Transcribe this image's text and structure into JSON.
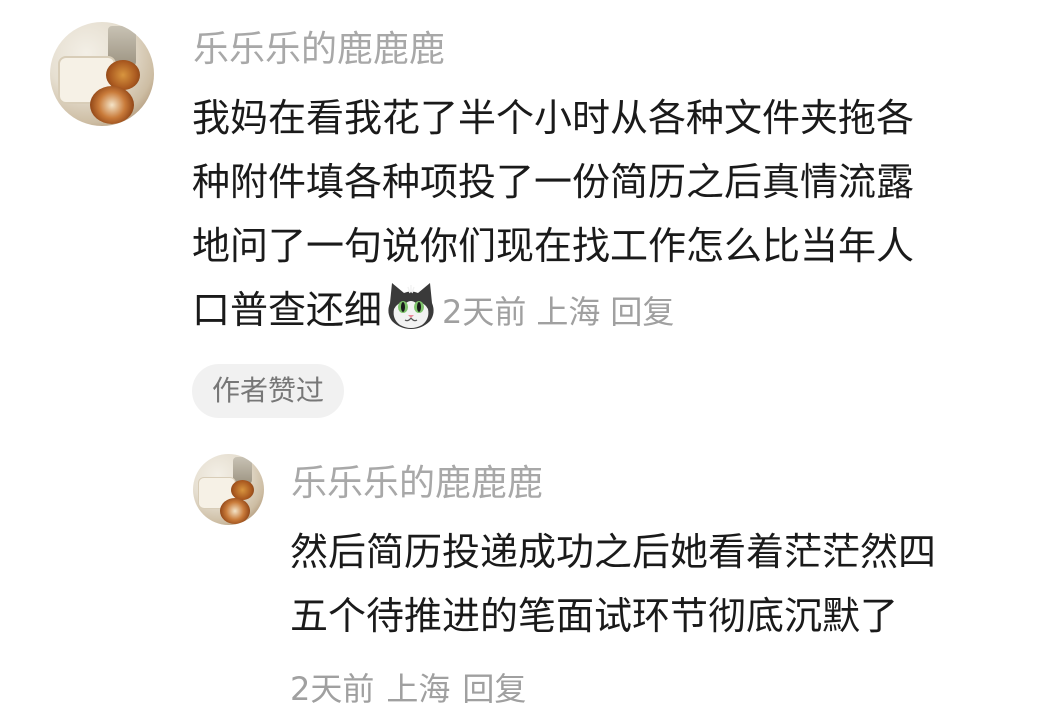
{
  "comment": {
    "username": "乐乐乐的鹿鹿鹿",
    "lines": [
      "我妈在看我花了半个小时从各种文件夹拖各",
      "种附件填各种项投了一份简历之后真情流露",
      "地问了一句说你们现在找工作怎么比当年人",
      "口普查还细"
    ],
    "emoji_icon": "cat-face-emoji",
    "time": "2天前",
    "location": "上海",
    "reply_label": "回复",
    "author_liked_badge": "作者赞过"
  },
  "reply": {
    "username": "乐乐乐的鹿鹿鹿",
    "lines": [
      "然后简历投递成功之后她看着茫茫然四",
      "五个待推进的笔面试环节彻底沉默了"
    ],
    "time": "2天前",
    "location": "上海",
    "reply_label": "回复"
  },
  "colors": {
    "username": "#a8a8a8",
    "content": "#1a1a1a",
    "meta": "#a0a0a0",
    "badge_bg": "#f1f1f1",
    "badge_text": "#777777"
  }
}
